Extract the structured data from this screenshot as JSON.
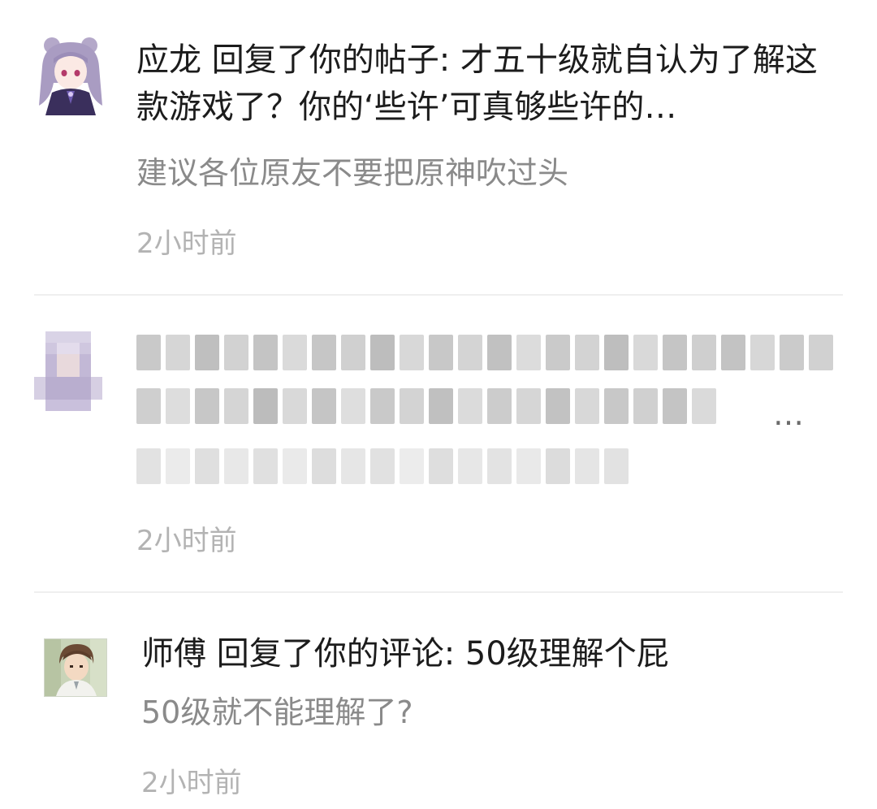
{
  "notifications": [
    {
      "avatar_icon": "character-avatar-icon",
      "title": "应龙 回复了你的帖子: 才五十级就自认为了解这款游戏了？你的‘些许’可真够些许的…",
      "preview": "建议各位原友不要把原神吹过头",
      "time": "2小时前"
    },
    {
      "avatar_icon": "pixelated-avatar-icon",
      "title": "…",
      "preview": "",
      "time": "2小时前"
    },
    {
      "avatar_icon": "anime-boy-avatar-icon",
      "title": "师傅 回复了你的评论: 50级理解个屁",
      "preview": "50级就不能理解了?",
      "time": "2小时前"
    }
  ],
  "colors": {
    "title": "#1c1c1c",
    "preview": "#8a8a8a",
    "time": "#b3b3b3",
    "divider": "#efefef"
  }
}
